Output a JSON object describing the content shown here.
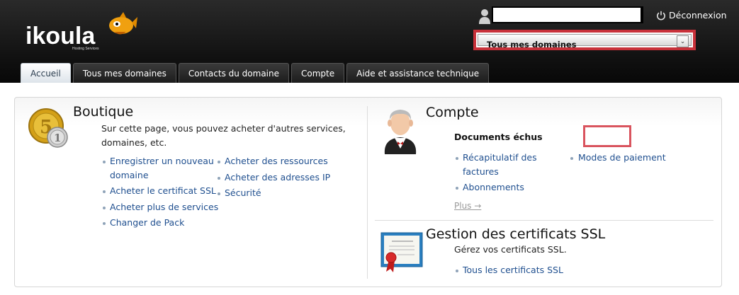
{
  "header": {
    "logo_text": "ikoula",
    "logo_tagline": "Hosting Services",
    "user_name": "",
    "logout_label": "Déconnexion",
    "domain_select": {
      "selected": "Tous mes domaines"
    }
  },
  "tabs": [
    {
      "label": "Accueil",
      "active": true
    },
    {
      "label": "Tous mes domaines",
      "active": false
    },
    {
      "label": "Contacts du domaine",
      "active": false
    },
    {
      "label": "Compte",
      "active": false
    },
    {
      "label": "Aide et assistance technique",
      "active": false
    }
  ],
  "boutique": {
    "title": "Boutique",
    "description_line1": "Sur cette page, vous pouvez acheter d'autres services,",
    "description_line2": "domaines, etc.",
    "links_col1": [
      {
        "line1": "Enregistrer un nouveau",
        "line2": "domaine"
      },
      {
        "line1": "Acheter le certificat SSL"
      },
      {
        "line1": "Acheter plus de services"
      },
      {
        "line1": "Changer de Pack"
      }
    ],
    "links_col2": [
      "Acheter des ressources",
      "Acheter des adresses IP",
      "Sécurité"
    ]
  },
  "compte": {
    "title": "Compte",
    "subheading": "Documents échus",
    "links_col1": [
      {
        "line1": "Récapitulatif des",
        "line2": "factures"
      },
      {
        "line1": "Abonnements"
      }
    ],
    "links_col2": [
      "Modes de paiement"
    ],
    "more": "Plus →"
  },
  "ssl": {
    "title": "Gestion des certificats SSL",
    "description": "Gérez vos certificats SSL.",
    "link": "Tous les certificats SSL"
  },
  "colors": {
    "accent_red": "#c8313a",
    "link_blue": "#1f4f8f",
    "header_bg": "#111111"
  }
}
